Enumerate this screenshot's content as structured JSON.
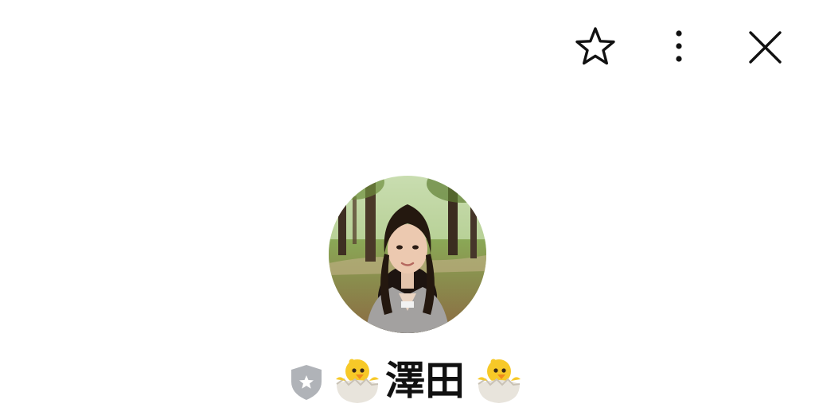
{
  "header": {
    "icons": [
      "star-outline-icon",
      "more-vertical-icon",
      "close-icon"
    ]
  },
  "profile": {
    "name": "澤田",
    "badge_icon": "shield-star-icon",
    "decoration_icon": "hatching-chick-emoji",
    "avatar_description_icon": "profile-photo"
  },
  "colors": {
    "background": "#ffffff",
    "icon": "#111111",
    "badge": "#b0b3b8"
  }
}
